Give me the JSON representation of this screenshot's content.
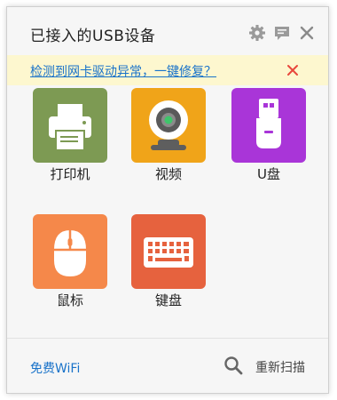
{
  "header": {
    "title": "已接入的USB设备",
    "icons": [
      "gear-icon",
      "chat-icon",
      "close-icon"
    ]
  },
  "notice": {
    "link_text": "检测到网卡驱动异常，一键修复？",
    "close_icon": "close-icon",
    "close_color": "#e8473c"
  },
  "devices": [
    {
      "label": "打印机",
      "icon": "printer-icon",
      "color": "#7d9a53"
    },
    {
      "label": "视频",
      "icon": "webcam-icon",
      "color": "#f0a419"
    },
    {
      "label": "U盘",
      "icon": "usb-drive-icon",
      "color": "#a935d8"
    },
    {
      "label": "鼠标",
      "icon": "mouse-icon",
      "color": "#f5884a"
    },
    {
      "label": "键盘",
      "icon": "keyboard-icon",
      "color": "#e6623e"
    }
  ],
  "footer": {
    "wifi_label": "免费WiFi",
    "rescan_label": "重新扫描",
    "rescan_icon": "search-icon"
  },
  "colors": {
    "link": "#1a73c9",
    "notice_bg": "#fdf7cf"
  }
}
